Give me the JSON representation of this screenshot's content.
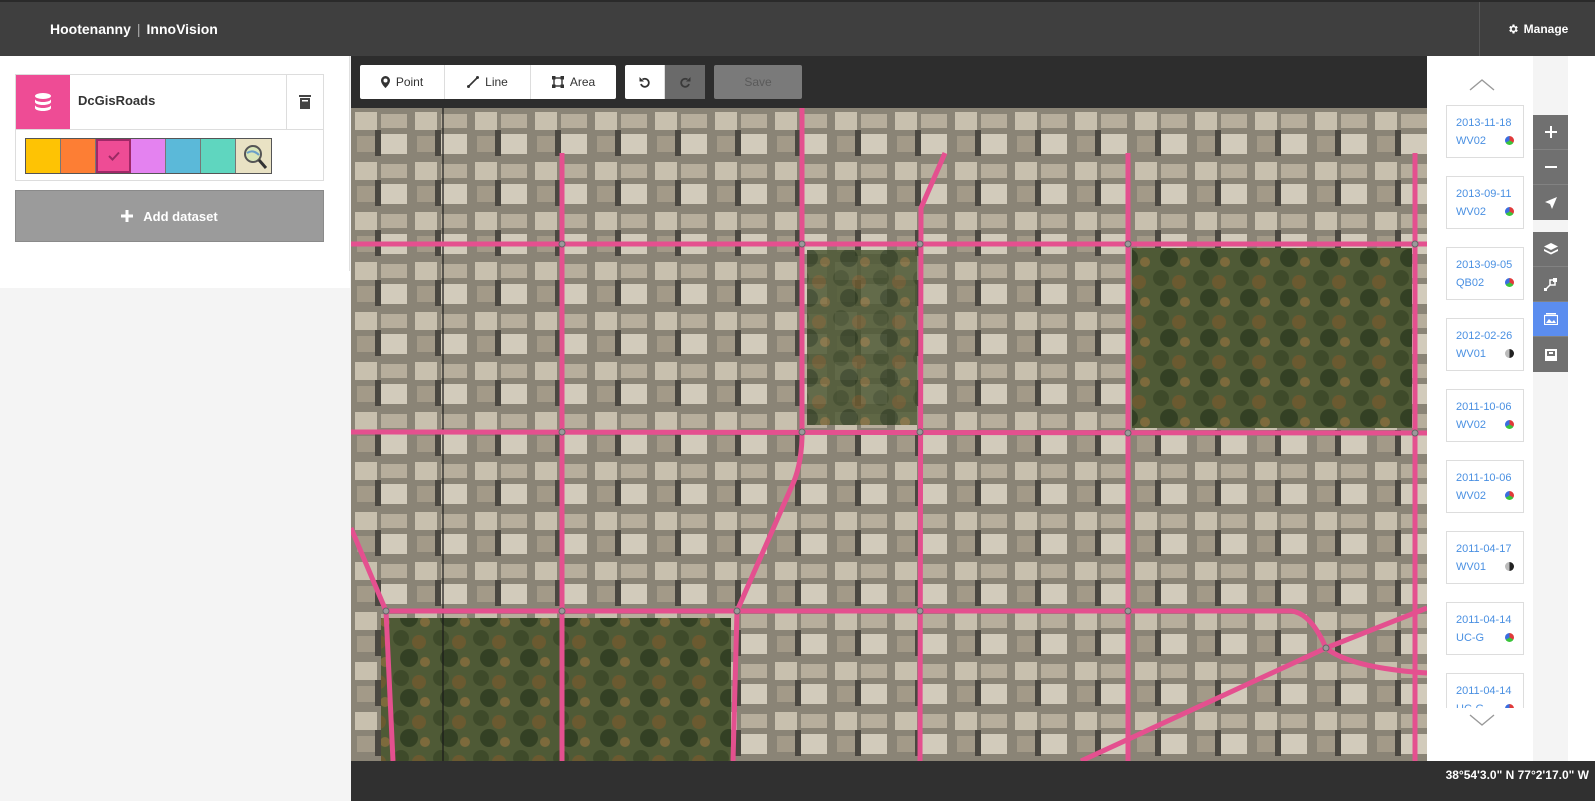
{
  "app": {
    "name": "Hootenanny",
    "separator": "|",
    "module": "InnoVision"
  },
  "header": {
    "manage_label": "Manage",
    "manage_icon": "gear-icon"
  },
  "sidebar": {
    "dataset": {
      "name": "DcGisRoads",
      "icon": "database-icon",
      "color": "#ee4c95"
    },
    "swatches": [
      {
        "color": "#fec304",
        "selected": false
      },
      {
        "color": "#fd7e34",
        "selected": false
      },
      {
        "color": "#ee4c95",
        "selected": true
      },
      {
        "color": "#e482f0",
        "selected": false
      },
      {
        "color": "#5bb9d9",
        "selected": false
      },
      {
        "color": "#5fd6bf",
        "selected": false
      },
      {
        "color": "osm",
        "selected": false
      }
    ],
    "add_dataset_label": "Add dataset"
  },
  "toolbar": {
    "point_label": "Point",
    "line_label": "Line",
    "area_label": "Area",
    "save_label": "Save"
  },
  "imagery": [
    {
      "date": "2013-11-18",
      "sensor": "WV02",
      "type": "color"
    },
    {
      "date": "2013-09-11",
      "sensor": "WV02",
      "type": "color"
    },
    {
      "date": "2013-09-05",
      "sensor": "QB02",
      "type": "color"
    },
    {
      "date": "2012-02-26",
      "sensor": "WV01",
      "type": "gray"
    },
    {
      "date": "2011-10-06",
      "sensor": "WV02",
      "type": "color"
    },
    {
      "date": "2011-10-06",
      "sensor": "WV02",
      "type": "color"
    },
    {
      "date": "2011-04-17",
      "sensor": "WV01",
      "type": "gray"
    },
    {
      "date": "2011-04-14",
      "sensor": "UC-G",
      "type": "color"
    },
    {
      "date": "2011-04-14",
      "sensor": "UC-G",
      "type": "color"
    }
  ],
  "map_controls": [
    "zoom-in-icon",
    "zoom-out-icon",
    "locate-icon",
    "layers-icon",
    "map-data-icon",
    "imagery-icon",
    "archive-icon"
  ],
  "status": {
    "coordinates": "38°54'3.0\" N 77°2'17.0\" W"
  },
  "colors": {
    "road": "#e4508f",
    "header": "#3f3f3f",
    "accent": "#5b8def"
  }
}
